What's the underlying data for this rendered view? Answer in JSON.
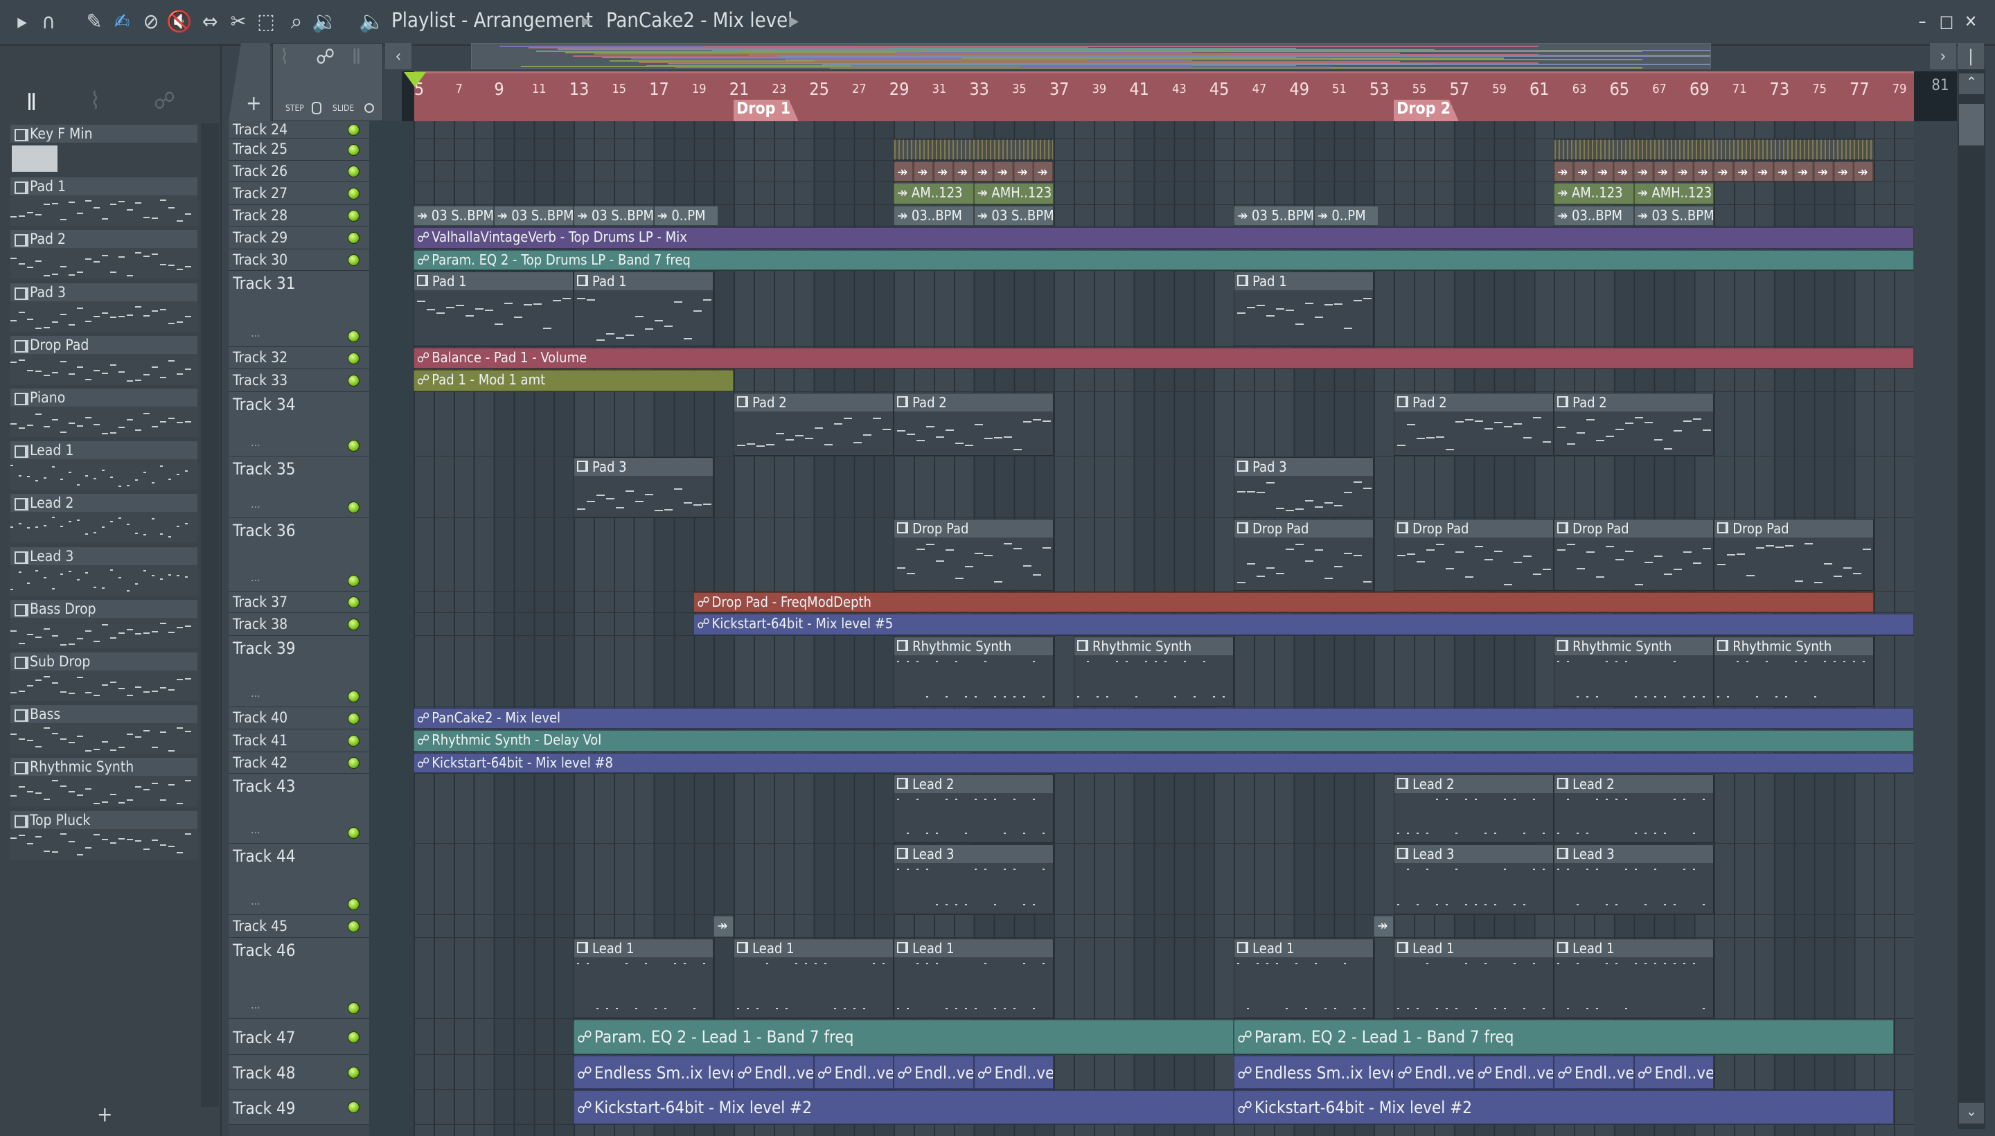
{
  "toolbar": {
    "icons": [
      "play-arrow-icon",
      "magnet-icon",
      "pencil-icon",
      "paint-icon",
      "delete-icon",
      "mute-icon",
      "slip-icon",
      "slice-icon",
      "select-icon",
      "zoom-icon",
      "playback-icon"
    ],
    "crumbs": [
      "Playlist - Arrangement",
      "PanCake2 - Mix level"
    ]
  },
  "panel": {
    "step_label": "STEP",
    "slide_label": "SLIDE",
    "add_label": "+",
    "items": [
      "Key F Min",
      "Pad 1",
      "Pad 2",
      "Pad 3",
      "Drop Pad",
      "Piano",
      "Lead 1",
      "Lead 2",
      "Lead 3",
      "Bass Drop",
      "Sub Drop",
      "Bass",
      "Rhythmic Synth",
      "Top Pluck"
    ]
  },
  "ruler": {
    "first_bar": 5,
    "last_bar": 81,
    "markers": [
      {
        "label": "Drop 1",
        "bar": 21
      },
      {
        "label": "Drop 2",
        "bar": 54
      }
    ]
  },
  "tracks": [
    {
      "name": "Track 24",
      "h": 25
    },
    {
      "name": "Track 25",
      "h": 32
    },
    {
      "name": "Track 26",
      "h": 31
    },
    {
      "name": "Track 27",
      "h": 33
    },
    {
      "name": "Track 28",
      "h": 31
    },
    {
      "name": "Track 29",
      "h": 33
    },
    {
      "name": "Track 30",
      "h": 31
    },
    {
      "name": "Track 31",
      "h": 110,
      "big": true
    },
    {
      "name": "Track 32",
      "h": 32
    },
    {
      "name": "Track 33",
      "h": 33
    },
    {
      "name": "Track 34",
      "h": 93,
      "big": true
    },
    {
      "name": "Track 35",
      "h": 89,
      "big": true
    },
    {
      "name": "Track 36",
      "h": 106,
      "big": true
    },
    {
      "name": "Track 37",
      "h": 31
    },
    {
      "name": "Track 38",
      "h": 33
    },
    {
      "name": "Track 39",
      "h": 103,
      "big": true
    },
    {
      "name": "Track 40",
      "h": 32
    },
    {
      "name": "Track 41",
      "h": 33
    },
    {
      "name": "Track 42",
      "h": 31
    },
    {
      "name": "Track 43",
      "h": 101,
      "big": true
    },
    {
      "name": "Track 44",
      "h": 103,
      "big": true
    },
    {
      "name": "Track 45",
      "h": 33
    },
    {
      "name": "Track 46",
      "h": 117,
      "big": true
    },
    {
      "name": "Track 47",
      "h": 52
    },
    {
      "name": "Track 48",
      "h": 50
    },
    {
      "name": "Track 49",
      "h": 51
    }
  ],
  "clips": [
    {
      "t": 1,
      "s": 29,
      "e": 37,
      "k": "stripe",
      "label": ""
    },
    {
      "t": 1,
      "s": 62,
      "e": 78,
      "k": "stripe",
      "label": ""
    },
    {
      "t": 2,
      "s": 29,
      "e": 37,
      "k": "slices",
      "label": ""
    },
    {
      "t": 2,
      "s": 62,
      "e": 78,
      "k": "slices",
      "label": ""
    },
    {
      "t": 3,
      "s": 29,
      "e": 33,
      "k": "green",
      "label": "AM..123"
    },
    {
      "t": 3,
      "s": 33,
      "e": 37,
      "k": "green",
      "label": "AMH..123"
    },
    {
      "t": 3,
      "s": 62,
      "e": 66,
      "k": "green",
      "label": "AM..123"
    },
    {
      "t": 3,
      "s": 66,
      "e": 70,
      "k": "green",
      "label": "AMH..123"
    },
    {
      "t": 4,
      "s": 5,
      "e": 9,
      "k": "aud",
      "label": "03 S..BPM"
    },
    {
      "t": 4,
      "s": 9,
      "e": 13,
      "k": "aud",
      "label": "03 S..BPM"
    },
    {
      "t": 4,
      "s": 13,
      "e": 17,
      "k": "aud",
      "label": "03 S..BPM"
    },
    {
      "t": 4,
      "s": 17,
      "e": 20.25,
      "k": "aud",
      "label": "0..PM"
    },
    {
      "t": 4,
      "s": 29,
      "e": 33,
      "k": "aud",
      "label": "03..BPM"
    },
    {
      "t": 4,
      "s": 33,
      "e": 37,
      "k": "aud",
      "label": "03 S..BPM"
    },
    {
      "t": 4,
      "s": 46,
      "e": 50,
      "k": "aud",
      "label": "03 5..BPM"
    },
    {
      "t": 4,
      "s": 50,
      "e": 53.25,
      "k": "aud",
      "label": "0..PM"
    },
    {
      "t": 4,
      "s": 62,
      "e": 66,
      "k": "aud",
      "label": "03..BPM"
    },
    {
      "t": 4,
      "s": 66,
      "e": 70,
      "k": "aud",
      "label": "03 S..BPM"
    },
    {
      "t": 5,
      "s": 5,
      "e": 80,
      "k": "auto",
      "c": "#5e5087",
      "label": "ValhallaVintageVerb - Top Drums LP - Mix"
    },
    {
      "t": 6,
      "s": 5,
      "e": 80,
      "k": "auto",
      "c": "#4e8580",
      "label": "Param. EQ 2 - Top Drums LP - Band 7 freq"
    },
    {
      "t": 7,
      "s": 5,
      "e": 13,
      "k": "pat",
      "label": "Pad 1"
    },
    {
      "t": 7,
      "s": 13,
      "e": 20,
      "k": "pat",
      "label": "Pad 1"
    },
    {
      "t": 7,
      "s": 46,
      "e": 53,
      "k": "pat",
      "label": "Pad 1"
    },
    {
      "t": 8,
      "s": 5,
      "e": 80,
      "k": "auto",
      "c": "#9c4d5e",
      "label": "Balance - Pad 1 - Volume"
    },
    {
      "t": 9,
      "s": 5,
      "e": 21,
      "k": "auto",
      "c": "#7b8542",
      "label": "Pad 1 - Mod 1 amt"
    },
    {
      "t": 10,
      "s": 21,
      "e": 29,
      "k": "pat",
      "label": "Pad 2"
    },
    {
      "t": 10,
      "s": 29,
      "e": 37,
      "k": "pat",
      "label": "Pad 2"
    },
    {
      "t": 10,
      "s": 54,
      "e": 62,
      "k": "pat",
      "label": "Pad 2"
    },
    {
      "t": 10,
      "s": 62,
      "e": 70,
      "k": "pat",
      "label": "Pad 2"
    },
    {
      "t": 11,
      "s": 13,
      "e": 20,
      "k": "pat",
      "label": "Pad 3"
    },
    {
      "t": 11,
      "s": 46,
      "e": 53,
      "k": "pat",
      "label": "Pad 3"
    },
    {
      "t": 12,
      "s": 29,
      "e": 37,
      "k": "pat",
      "label": "Drop Pad"
    },
    {
      "t": 12,
      "s": 46,
      "e": 53,
      "k": "pat",
      "label": "Drop Pad"
    },
    {
      "t": 12,
      "s": 54,
      "e": 62,
      "k": "pat",
      "label": "Drop Pad"
    },
    {
      "t": 12,
      "s": 62,
      "e": 70,
      "k": "pat",
      "label": "Drop Pad"
    },
    {
      "t": 12,
      "s": 70,
      "e": 78,
      "k": "pat",
      "label": "Drop Pad"
    },
    {
      "t": 13,
      "s": 19,
      "e": 78,
      "k": "auto",
      "c": "#9a4c44",
      "label": "Drop Pad - FreqModDepth"
    },
    {
      "t": 14,
      "s": 19,
      "e": 80,
      "k": "auto",
      "c": "#4f5892",
      "label": "Kickstart-64bit - Mix level #5"
    },
    {
      "t": 15,
      "s": 29,
      "e": 37,
      "k": "pat",
      "label": "Rhythmic Synth"
    },
    {
      "t": 15,
      "s": 38,
      "e": 46,
      "k": "pat",
      "label": "Rhythmic Synth"
    },
    {
      "t": 15,
      "s": 62,
      "e": 70,
      "k": "pat",
      "label": "Rhythmic Synth"
    },
    {
      "t": 15,
      "s": 70,
      "e": 78,
      "k": "pat",
      "label": "Rhythmic Synth"
    },
    {
      "t": 16,
      "s": 5,
      "e": 80,
      "k": "auto",
      "c": "#4f5892",
      "label": "PanCake2 - Mix level"
    },
    {
      "t": 17,
      "s": 5,
      "e": 80,
      "k": "auto",
      "c": "#4e8580",
      "label": "Rhythmic Synth - Delay Vol"
    },
    {
      "t": 18,
      "s": 5,
      "e": 80,
      "k": "auto",
      "c": "#4f5892",
      "label": "Kickstart-64bit - Mix level #8"
    },
    {
      "t": 19,
      "s": 29,
      "e": 37,
      "k": "pat",
      "label": "Lead 2"
    },
    {
      "t": 19,
      "s": 54,
      "e": 62,
      "k": "pat",
      "label": "Lead 2"
    },
    {
      "t": 19,
      "s": 62,
      "e": 70,
      "k": "pat",
      "label": "Lead 2"
    },
    {
      "t": 20,
      "s": 29,
      "e": 37,
      "k": "pat",
      "label": "Lead 3"
    },
    {
      "t": 20,
      "s": 54,
      "e": 62,
      "k": "pat",
      "label": "Lead 3"
    },
    {
      "t": 20,
      "s": 62,
      "e": 70,
      "k": "pat",
      "label": "Lead 3"
    },
    {
      "t": 21,
      "s": 20,
      "e": 21,
      "k": "aud",
      "label": "↠"
    },
    {
      "t": 21,
      "s": 53,
      "e": 54,
      "k": "aud",
      "label": "↠"
    },
    {
      "t": 22,
      "s": 13,
      "e": 20,
      "k": "pat",
      "label": "Lead 1"
    },
    {
      "t": 22,
      "s": 21,
      "e": 29,
      "k": "pat",
      "label": "Lead 1"
    },
    {
      "t": 22,
      "s": 29,
      "e": 37,
      "k": "pat",
      "label": "Lead 1"
    },
    {
      "t": 22,
      "s": 46,
      "e": 53,
      "k": "pat",
      "label": "Lead 1"
    },
    {
      "t": 22,
      "s": 54,
      "e": 62,
      "k": "pat",
      "label": "Lead 1"
    },
    {
      "t": 22,
      "s": 62,
      "e": 70,
      "k": "pat",
      "label": "Lead 1"
    },
    {
      "t": 23,
      "s": 13,
      "e": 46,
      "k": "auto",
      "c": "#4e8580",
      "label": "Param. EQ 2 - Lead 1 - Band 7 freq"
    },
    {
      "t": 23,
      "s": 46,
      "e": 79,
      "k": "auto",
      "c": "#4e8580",
      "label": "Param. EQ 2 - Lead 1 - Band 7 freq"
    },
    {
      "t": 24,
      "s": 13,
      "e": 21,
      "k": "auto",
      "c": "#4f5892",
      "label": "Endless Sm..ix level"
    },
    {
      "t": 24,
      "s": 21,
      "e": 25,
      "k": "auto",
      "c": "#4f5892",
      "label": "Endl..vel"
    },
    {
      "t": 24,
      "s": 25,
      "e": 29,
      "k": "auto",
      "c": "#4f5892",
      "label": "Endl..vel"
    },
    {
      "t": 24,
      "s": 29,
      "e": 33,
      "k": "auto",
      "c": "#4f5892",
      "label": "Endl..vel"
    },
    {
      "t": 24,
      "s": 33,
      "e": 37,
      "k": "auto",
      "c": "#4f5892",
      "label": "Endl..vel"
    },
    {
      "t": 24,
      "s": 46,
      "e": 54,
      "k": "auto",
      "c": "#4f5892",
      "label": "Endless Sm..ix level"
    },
    {
      "t": 24,
      "s": 54,
      "e": 58,
      "k": "auto",
      "c": "#4f5892",
      "label": "Endl..vel"
    },
    {
      "t": 24,
      "s": 58,
      "e": 62,
      "k": "auto",
      "c": "#4f5892",
      "label": "Endl..vel"
    },
    {
      "t": 24,
      "s": 62,
      "e": 66,
      "k": "auto",
      "c": "#4f5892",
      "label": "Endl..vel"
    },
    {
      "t": 24,
      "s": 66,
      "e": 70,
      "k": "auto",
      "c": "#4f5892",
      "label": "Endl..vel"
    },
    {
      "t": 25,
      "s": 13,
      "e": 46,
      "k": "auto",
      "c": "#4f5892",
      "label": "Kickstart-64bit - Mix level #2"
    },
    {
      "t": 25,
      "s": 46,
      "e": 79,
      "k": "auto",
      "c": "#4f5892",
      "label": "Kickstart-64bit - Mix level #2"
    }
  ]
}
